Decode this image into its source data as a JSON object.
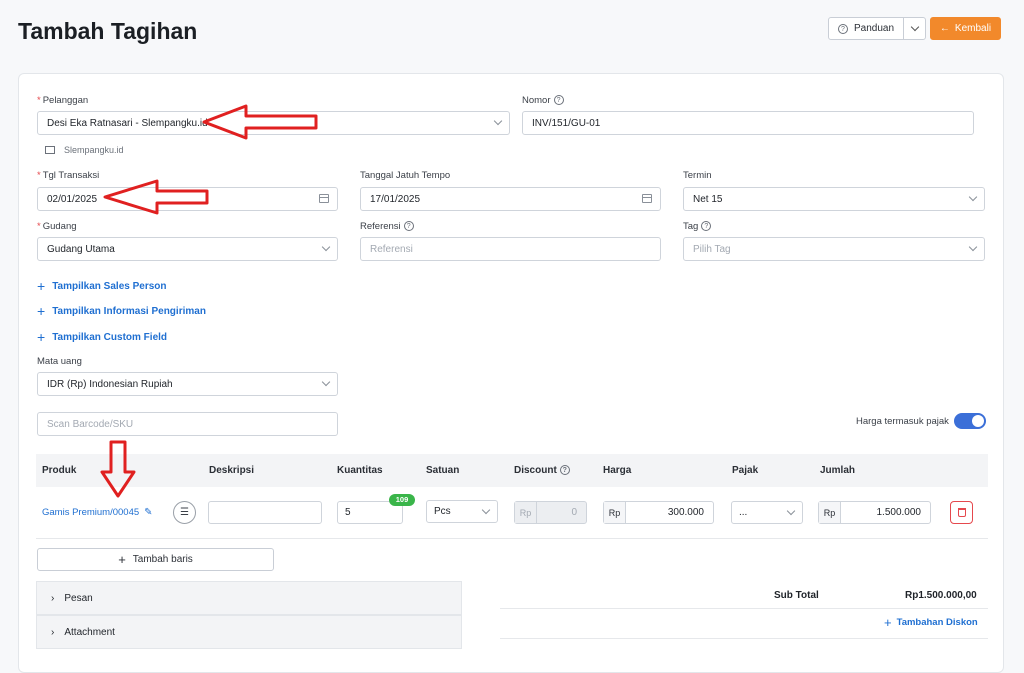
{
  "page": {
    "title": "Tambah Tagihan"
  },
  "header": {
    "guide_label": "Panduan",
    "back_label": "Kembali"
  },
  "form": {
    "customer": {
      "label": "Pelanggan",
      "value": "Desi Eka Ratnasari - Slempangku.id",
      "note": "Slempangku.id"
    },
    "number": {
      "label": "Nomor",
      "value": "INV/151/GU-01"
    },
    "transaction_date": {
      "label": "Tgl Transaksi",
      "value": "02/01/2025"
    },
    "due_date": {
      "label": "Tanggal Jatuh Tempo",
      "value": "17/01/2025"
    },
    "term": {
      "label": "Termin",
      "value": "Net 15"
    },
    "warehouse": {
      "label": "Gudang",
      "value": "Gudang Utama"
    },
    "reference": {
      "label": "Referensi",
      "placeholder": "Referensi"
    },
    "tag": {
      "label": "Tag",
      "placeholder": "Pilih Tag"
    },
    "links": {
      "sales_person": "Tampilkan Sales Person",
      "shipping": "Tampilkan Informasi Pengiriman",
      "custom_field": "Tampilkan Custom Field"
    },
    "currency": {
      "label": "Mata uang",
      "value": "IDR (Rp) Indonesian Rupiah"
    },
    "barcode": {
      "placeholder": "Scan Barcode/SKU"
    },
    "tax_inclusive_label": "Harga termasuk pajak"
  },
  "table": {
    "headers": {
      "product": "Produk",
      "description": "Deskripsi",
      "quantity": "Kuantitas",
      "unit": "Satuan",
      "discount": "Discount",
      "price": "Harga",
      "tax": "Pajak",
      "amount": "Jumlah"
    },
    "rows": [
      {
        "product": "Gamis Premium/00045",
        "quantity": "5",
        "stock_badge": "109",
        "unit": "Pcs",
        "discount_prefix": "Rp",
        "discount": "0",
        "price_prefix": "Rp",
        "price": "300.000",
        "tax": "...",
        "amount_prefix": "Rp",
        "amount": "1.500.000"
      }
    ],
    "add_row_label": "Tambah baris"
  },
  "sections": {
    "message": "Pesan",
    "attachment": "Attachment"
  },
  "totals": {
    "subtotal_label": "Sub Total",
    "subtotal_value": "Rp1.500.000,00",
    "add_discount_label": "Tambahan Diskon"
  },
  "colors": {
    "accent": "#f2892b",
    "link": "#1f6fd1",
    "annotation": "#e02020"
  }
}
